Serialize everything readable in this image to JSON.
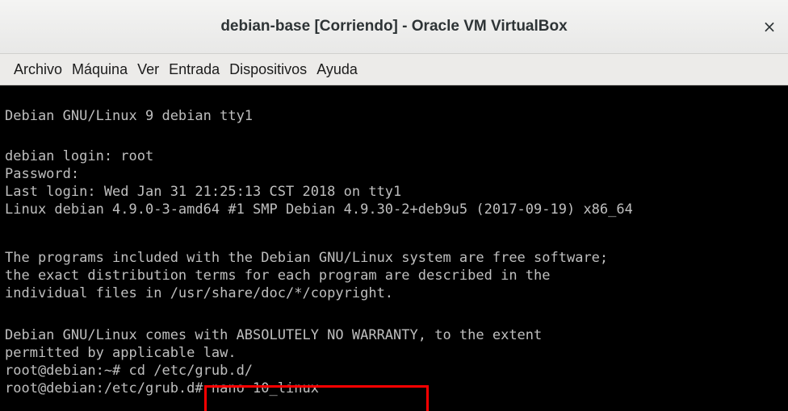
{
  "window": {
    "title": "debian-base [Corriendo] - Oracle VM VirtualBox",
    "close_glyph": "×"
  },
  "menu": {
    "items": [
      "Archivo",
      "Máquina",
      "Ver",
      "Entrada",
      "Dispositivos",
      "Ayuda"
    ]
  },
  "console": {
    "lines": [
      "Debian GNU/Linux 9 debian tty1",
      "debian login: root",
      "Password:",
      "Last login: Wed Jan 31 21:25:13 CST 2018 on tty1",
      "Linux debian 4.9.0-3-amd64 #1 SMP Debian 4.9.30-2+deb9u5 (2017-09-19) x86_64",
      "The programs included with the Debian GNU/Linux system are free software;",
      "the exact distribution terms for each program are described in the",
      "individual files in /usr/share/doc/*/copyright.",
      "Debian GNU/Linux comes with ABSOLUTELY NO WARRANTY, to the extent",
      "permitted by applicable law.",
      "root@debian:~# cd /etc/grub.d/",
      "root@debian:/etc/grub.d# nano 10_linux"
    ]
  },
  "colors": {
    "highlight": "#ff0000",
    "console_text": "#bfbfbf",
    "console_bg": "#000000"
  }
}
